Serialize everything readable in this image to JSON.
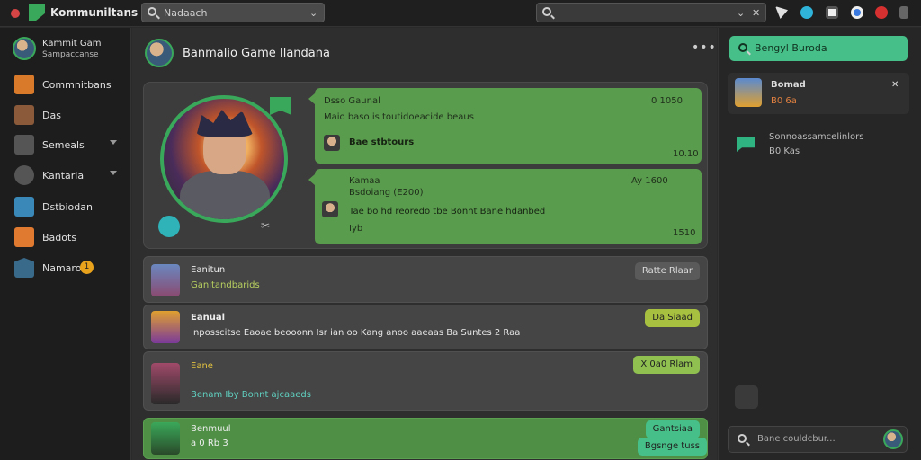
{
  "app": {
    "title": "Kommuniltans"
  },
  "search_left": {
    "value": "Nadaach"
  },
  "sidebar": {
    "user_name": "Kammit Gam",
    "user_sub": "Sampaccanse",
    "items": [
      {
        "label": "Commnitbans",
        "icon": "commnit-icon",
        "color": "#d97a2a"
      },
      {
        "label": "Das",
        "icon": "game-icon",
        "color": "#8a5a3a"
      },
      {
        "label": "Semeals",
        "icon": "check-icon",
        "color": "#555555"
      },
      {
        "label": "Kantaria",
        "icon": "settings-icon",
        "color": "#555555"
      },
      {
        "label": "Dstbiodan",
        "icon": "map-icon",
        "color": "#3a88b8"
      },
      {
        "label": "Badots",
        "icon": "badge-icon",
        "color": "#e07a30"
      },
      {
        "label": "Namaro",
        "icon": "inbox-icon",
        "color": "#3a6a8a",
        "badge": "1"
      }
    ]
  },
  "main": {
    "header_title": "Banmalio Game Ilandana",
    "featured": {
      "bubble1": {
        "author": "Dsso Gaunal",
        "body": "Maio baso is toutidoeacide beaus",
        "time_top": "0 1050",
        "reply": "Bae stbtours",
        "time_bottom": "10.10"
      },
      "bubble2": {
        "author": "Kamaa",
        "sub": "Bsdoiang (E200)",
        "time_top": "Ay 1600",
        "body": "Tae bo hd reoredo tbe Bonnt Bane hdanbed",
        "extra": "Iyb",
        "time_bottom": "1510"
      }
    },
    "list": [
      {
        "name": "Eanitun",
        "sub": "Ganitandbarids",
        "pill": "Ratte Rlaar",
        "pill_color": "#5a5a5a",
        "green": false
      },
      {
        "name": "Eanual",
        "sub": "Inposscitse Eaoae beooonn Isr ian oo Kang anoo aaeaas Ba Suntes 2 Raa",
        "pill": "Da Siaad",
        "pill_color": "#a8c040",
        "green": false
      },
      {
        "name": "Eane",
        "sub": "Benam Iby Bonnt ajcaaeds",
        "pill": "X 0a0 Rlam",
        "pill_color": "#8fc050",
        "green": false
      },
      {
        "name": "Benmuul",
        "sub": "a 0 Rb 3",
        "pill": "Gantsiaa",
        "pill2": "Bgsnge tuss",
        "pill_color": "#46c088",
        "green": true
      }
    ]
  },
  "right": {
    "button_label": "Bengyl Buroda",
    "card1_title": "Bomad",
    "card1_sub": "B0 6a",
    "card2_title": "Sonnoassamcelinlors",
    "card2_sub": "B0 Kas",
    "input_placeholder": "Bane couldcbur..."
  }
}
